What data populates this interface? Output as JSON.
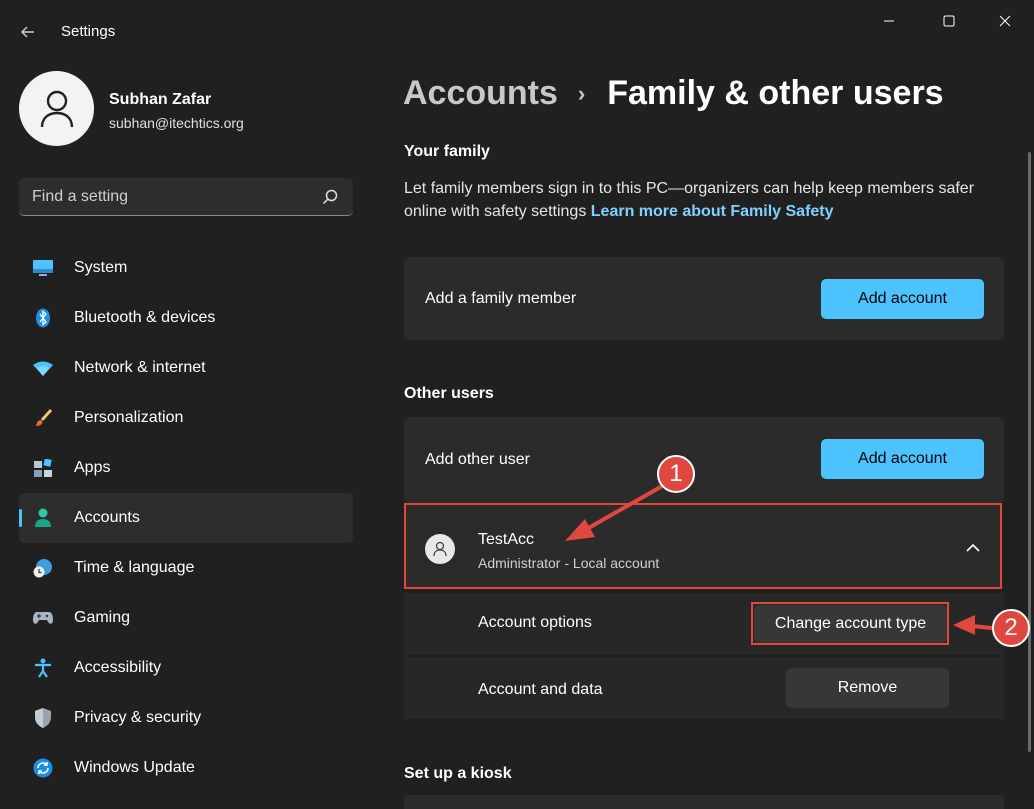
{
  "window": {
    "title": "Settings"
  },
  "profile": {
    "name": "Subhan Zafar",
    "email": "subhan@itechtics.org"
  },
  "search": {
    "placeholder": "Find a setting"
  },
  "nav": {
    "items": [
      {
        "label": "System",
        "icon": "monitor-icon"
      },
      {
        "label": "Bluetooth & devices",
        "icon": "bluetooth-icon"
      },
      {
        "label": "Network & internet",
        "icon": "wifi-icon"
      },
      {
        "label": "Personalization",
        "icon": "brush-icon"
      },
      {
        "label": "Apps",
        "icon": "apps-icon"
      },
      {
        "label": "Accounts",
        "icon": "person-icon",
        "active": true
      },
      {
        "label": "Time & language",
        "icon": "globe-clock-icon"
      },
      {
        "label": "Gaming",
        "icon": "gamepad-icon"
      },
      {
        "label": "Accessibility",
        "icon": "accessibility-icon"
      },
      {
        "label": "Privacy & security",
        "icon": "shield-icon"
      },
      {
        "label": "Windows Update",
        "icon": "update-icon"
      }
    ]
  },
  "breadcrumb": {
    "parent": "Accounts",
    "separator": "›",
    "current": "Family & other users"
  },
  "family": {
    "heading": "Your family",
    "description": "Let family members sign in to this PC—organizers can help keep members safer online with safety settings",
    "link": "Learn more about Family Safety",
    "add_label": "Add a family member",
    "add_button": "Add account"
  },
  "other_users": {
    "heading": "Other users",
    "add_label": "Add other user",
    "add_button": "Add account",
    "user": {
      "name": "TestAcc",
      "subtitle": "Administrator - Local account"
    },
    "options": {
      "account_options_label": "Account options",
      "change_type_button": "Change account type",
      "account_data_label": "Account and data",
      "remove_button": "Remove"
    }
  },
  "kiosk": {
    "heading": "Set up a kiosk"
  },
  "annotations": {
    "badge_1": "1",
    "badge_2": "2"
  },
  "colors": {
    "accent": "#4cc2ff",
    "annotation_red": "#e0473f",
    "background": "#202020",
    "card": "#2b2b2b"
  }
}
